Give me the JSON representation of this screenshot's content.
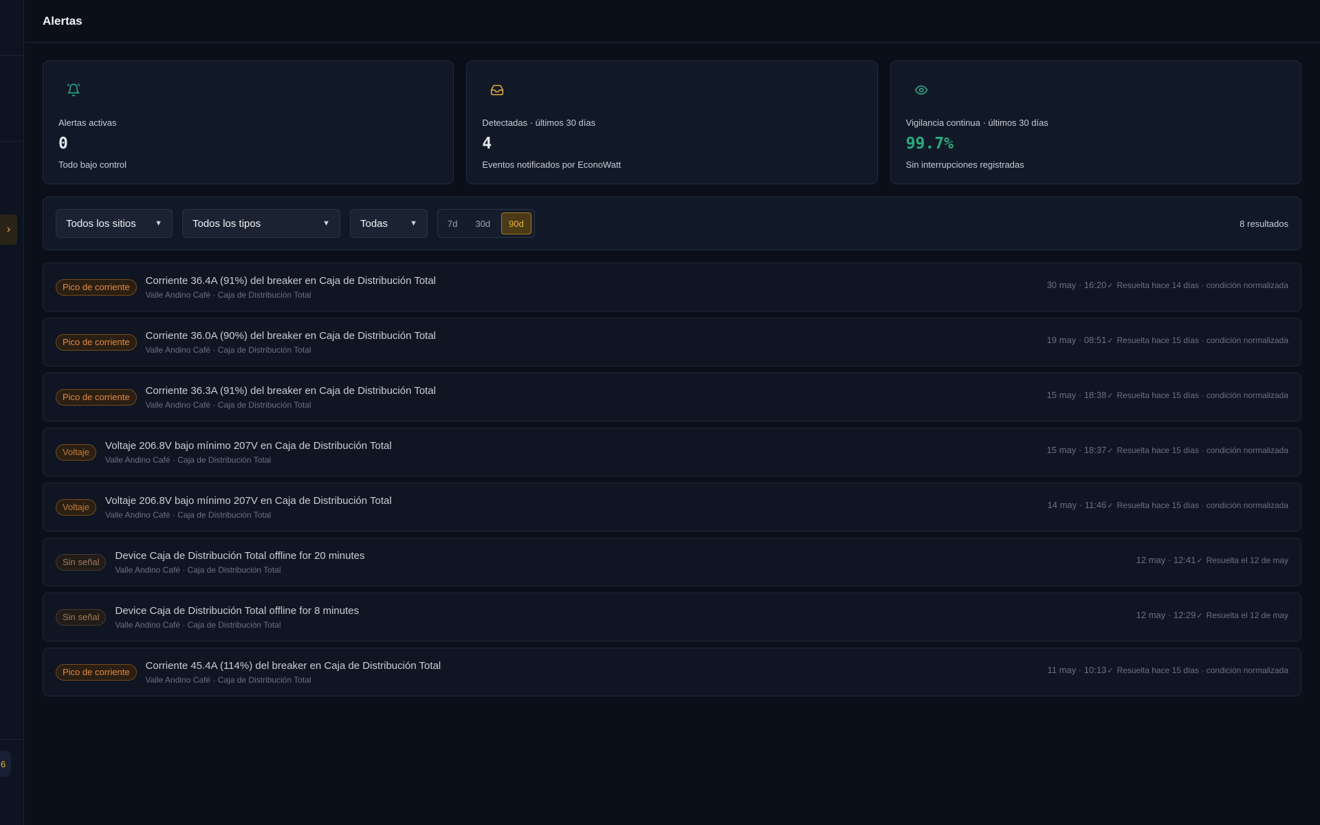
{
  "header": {
    "title": "Alertas"
  },
  "sidebar": {
    "expand_icon": "chevron-right-icon",
    "mini_badge": "6"
  },
  "stats": [
    {
      "icon": "bell-icon",
      "label": "Alertas activas",
      "value": "0",
      "sub": "Todo bajo control"
    },
    {
      "icon": "inbox-icon",
      "label": "Detectadas · últimos 30 días",
      "value": "4",
      "sub": "Eventos notificados por EconoWatt"
    },
    {
      "icon": "eye-icon",
      "label": "Vigilancia continua · últimos 30 días",
      "value": "99.7%",
      "sub": "Sin interrupciones registradas"
    }
  ],
  "filters": {
    "site_select": "Todos los sitios",
    "type_select": "Todos los tipos",
    "severity_select": "Todas",
    "ranges": [
      "7d",
      "30d",
      "90d"
    ],
    "active_range": "90d",
    "results": "8 resultados"
  },
  "alerts": [
    {
      "badge": "Pico de corriente",
      "title": "Corriente 36.4A (91%) del breaker en Caja de Distribución Total",
      "sub": "Valle Andino Café · Caja de Distribución Total",
      "time": "30 may · 16:20",
      "status": "Resuelta hace 14 días · condición normalizada"
    },
    {
      "badge": "Pico de corriente",
      "title": "Corriente 36.0A (90%) del breaker en Caja de Distribución Total",
      "sub": "Valle Andino Café · Caja de Distribución Total",
      "time": "19 may · 08:51",
      "status": "Resuelta hace 15 días · condición normalizada"
    },
    {
      "badge": "Pico de corriente",
      "title": "Corriente 36.3A (91%) del breaker en Caja de Distribución Total",
      "sub": "Valle Andino Café · Caja de Distribución Total",
      "time": "15 may · 18:38",
      "status": "Resuelta hace 15 días · condición normalizada"
    },
    {
      "badge": "Voltaje",
      "title": "Voltaje 206.8V bajo mínimo 207V en Caja de Distribución Total",
      "sub": "Valle Andino Café · Caja de Distribución Total",
      "time": "15 may · 18:37",
      "status": "Resuelta hace 15 días · condición normalizada"
    },
    {
      "badge": "Voltaje",
      "title": "Voltaje 206.8V bajo mínimo 207V en Caja de Distribución Total",
      "sub": "Valle Andino Café · Caja de Distribución Total",
      "time": "14 may · 11:46",
      "status": "Resuelta hace 15 días · condición normalizada"
    },
    {
      "badge": "Sin señal",
      "title": "Device Caja de Distribución Total offline for 20 minutes",
      "sub": "Valle Andino Café · Caja de Distribución Total",
      "time": "12 may · 12:41",
      "status": "Resuelta el 12 de may"
    },
    {
      "badge": "Sin señal",
      "title": "Device Caja de Distribución Total offline for 8 minutes",
      "sub": "Valle Andino Café · Caja de Distribución Total",
      "time": "12 may · 12:29",
      "status": "Resuelta el 12 de may"
    },
    {
      "badge": "Pico de corriente",
      "title": "Corriente 45.4A (114%) del breaker en Caja de Distribución Total",
      "sub": "Valle Andino Café · Caja de Distribución Total",
      "time": "11 may · 10:13",
      "status": "Resuelta hace 15 días · condición normalizada"
    }
  ],
  "colors": {
    "accent": "#f0b429",
    "green": "#22b07d",
    "teal_icon": "#2bb58a",
    "background": "#0a0f1a",
    "card": "#111827"
  }
}
